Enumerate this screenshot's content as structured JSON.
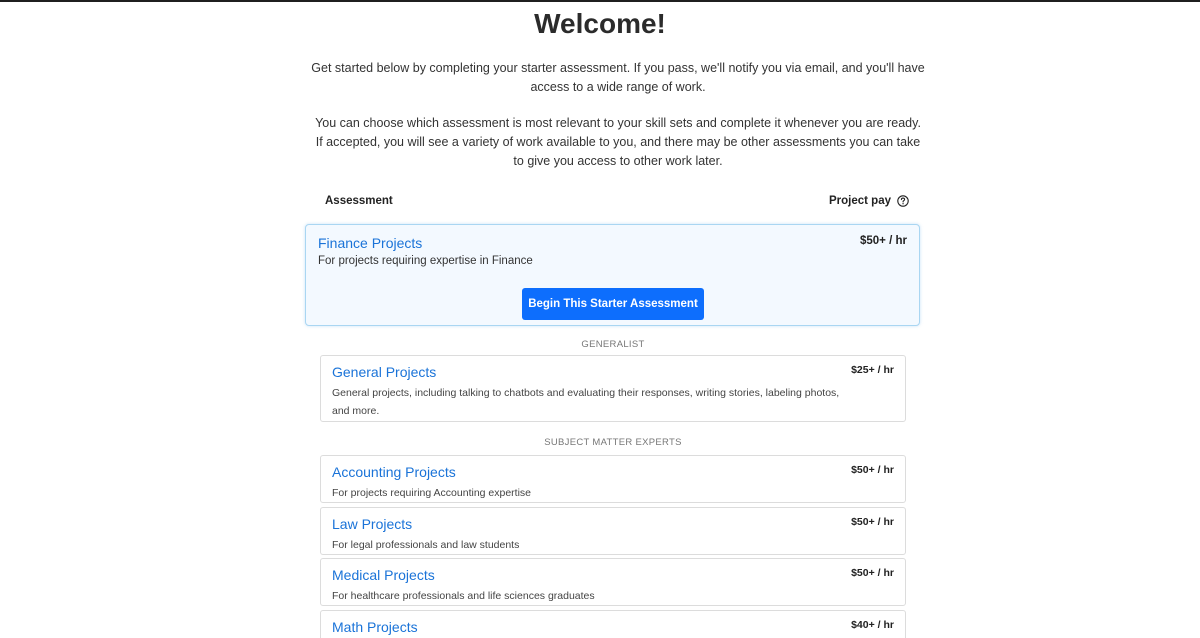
{
  "title": "Welcome!",
  "intro": {
    "p1": "Get started below by completing your starter assessment. If you pass, we'll notify you via email, and you'll have access to a wide range of work.",
    "p2": "You can choose which assessment is most relevant to your skill sets and complete it whenever you are ready. If accepted, you will see a variety of work available to you, and there may be other assessments you can take to give you access to other work later."
  },
  "table_header": {
    "assessment": "Assessment",
    "project_pay": "Project pay",
    "help_icon": "question-circle-icon"
  },
  "featured": {
    "title": "Finance Projects",
    "description": "For projects requiring expertise in Finance",
    "pay": "$50+ / hr",
    "button_label": "Begin This Starter Assessment"
  },
  "sections": {
    "generalist": "GENERALIST",
    "sme": "SUBJECT MATTER EXPERTS"
  },
  "cards": {
    "general": {
      "title": "General Projects",
      "description": "General projects, including talking to chatbots and evaluating their responses, writing stories, labeling photos, and more.",
      "pay": "$25+ / hr"
    },
    "accounting": {
      "title": "Accounting Projects",
      "description": "For projects requiring Accounting expertise",
      "pay": "$50+ / hr"
    },
    "law": {
      "title": "Law Projects",
      "description": "For legal professionals and law students",
      "pay": "$50+ / hr"
    },
    "medical": {
      "title": "Medical Projects",
      "description": "For healthcare professionals and life sciences graduates",
      "pay": "$50+ / hr"
    },
    "math": {
      "title": "Math Projects",
      "description": "",
      "pay": "$40+ / hr"
    }
  },
  "colors": {
    "accent": "#0d6efd",
    "link": "#1a73d8",
    "featured_bg": "#f3f9ff",
    "featured_border": "#a9d6f2"
  }
}
